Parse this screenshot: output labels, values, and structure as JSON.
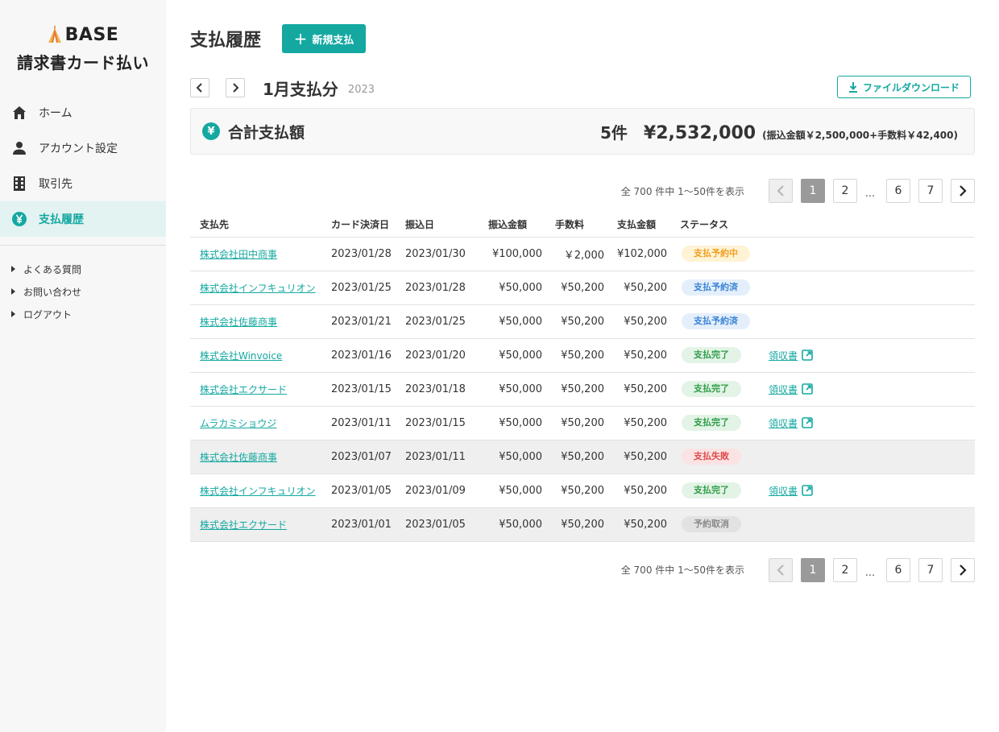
{
  "brand": {
    "logo_text": "BASE",
    "subtitle": "請求書カード払い"
  },
  "nav": {
    "items": [
      {
        "label": "ホーム",
        "icon": "home-icon"
      },
      {
        "label": "アカウント設定",
        "icon": "person-icon"
      },
      {
        "label": "取引先",
        "icon": "building-icon"
      },
      {
        "label": "支払履歴",
        "icon": "yen-icon",
        "active": true
      }
    ],
    "sub_items": [
      {
        "label": "よくある質問"
      },
      {
        "label": "お問い合わせ"
      },
      {
        "label": "ログアウト"
      }
    ]
  },
  "header": {
    "title": "支払履歴",
    "new_button": "新規支払"
  },
  "period": {
    "label": "1月支払分",
    "year": "2023",
    "download_button": "ファイルダウンロード"
  },
  "total": {
    "label": "合計支払額",
    "yen_symbol": "¥",
    "count": "5件",
    "amount": "¥2,532,000",
    "breakdown": "(振込金額￥2,500,000+手数料￥42,400)"
  },
  "pagination": {
    "summary": "全 700 件中 1〜50件を表示",
    "pages": [
      "1",
      "2",
      "6",
      "7"
    ],
    "ellipsis": "...",
    "current": "1"
  },
  "table": {
    "columns": [
      "支払先",
      "カード決済日",
      "振込日",
      "振込金額",
      "手数料",
      "支払金額",
      "ステータス"
    ],
    "rows": [
      {
        "payee": "株式会社田中商事",
        "card_date": "2023/01/28",
        "transfer_date": "2023/01/30",
        "transfer_amount": "¥100,000",
        "fee": "￥2,000",
        "payment": "¥102,000",
        "status": "支払予約中",
        "status_type": "reserving",
        "receipt": ""
      },
      {
        "payee": "株式会社インフキュリオン",
        "card_date": "2023/01/25",
        "transfer_date": "2023/01/28",
        "transfer_amount": "¥50,000",
        "fee": "¥50,200",
        "payment": "¥50,200",
        "status": "支払予約済",
        "status_type": "reserved",
        "receipt": ""
      },
      {
        "payee": "株式会社佐藤商事",
        "card_date": "2023/01/21",
        "transfer_date": "2023/01/25",
        "transfer_amount": "¥50,000",
        "fee": "¥50,200",
        "payment": "¥50,200",
        "status": "支払予約済",
        "status_type": "reserved",
        "receipt": ""
      },
      {
        "payee": "株式会社Winvoice",
        "card_date": "2023/01/16",
        "transfer_date": "2023/01/20",
        "transfer_amount": "¥50,000",
        "fee": "¥50,200",
        "payment": "¥50,200",
        "status": "支払完了",
        "status_type": "done",
        "receipt": "領収書"
      },
      {
        "payee": "株式会社エクサード",
        "card_date": "2023/01/15",
        "transfer_date": "2023/01/18",
        "transfer_amount": "¥50,000",
        "fee": "¥50,200",
        "payment": "¥50,200",
        "status": "支払完了",
        "status_type": "done",
        "receipt": "領収書"
      },
      {
        "payee": "ムラカミショウジ",
        "card_date": "2023/01/11",
        "transfer_date": "2023/01/15",
        "transfer_amount": "¥50,000",
        "fee": "¥50,200",
        "payment": "¥50,200",
        "status": "支払完了",
        "status_type": "done",
        "receipt": "領収書"
      },
      {
        "payee": "株式会社佐藤商事",
        "card_date": "2023/01/07",
        "transfer_date": "2023/01/11",
        "transfer_amount": "¥50,000",
        "fee": "¥50,200",
        "payment": "¥50,200",
        "status": "支払失敗",
        "status_type": "failed",
        "receipt": "",
        "dim": true
      },
      {
        "payee": "株式会社インフキュリオン",
        "card_date": "2023/01/05",
        "transfer_date": "2023/01/09",
        "transfer_amount": "¥50,000",
        "fee": "¥50,200",
        "payment": "¥50,200",
        "status": "支払完了",
        "status_type": "done",
        "receipt": "領収書"
      },
      {
        "payee": "株式会社エクサード",
        "card_date": "2023/01/01",
        "transfer_date": "2023/01/05",
        "transfer_amount": "¥50,000",
        "fee": "¥50,200",
        "payment": "¥50,200",
        "status": "予約取消",
        "status_type": "cancel",
        "receipt": "",
        "dim": true
      }
    ]
  },
  "colors": {
    "accent": "#14a8a1",
    "sidebar_bg": "#f7f7f7",
    "active_bg": "#e2f3f2"
  }
}
